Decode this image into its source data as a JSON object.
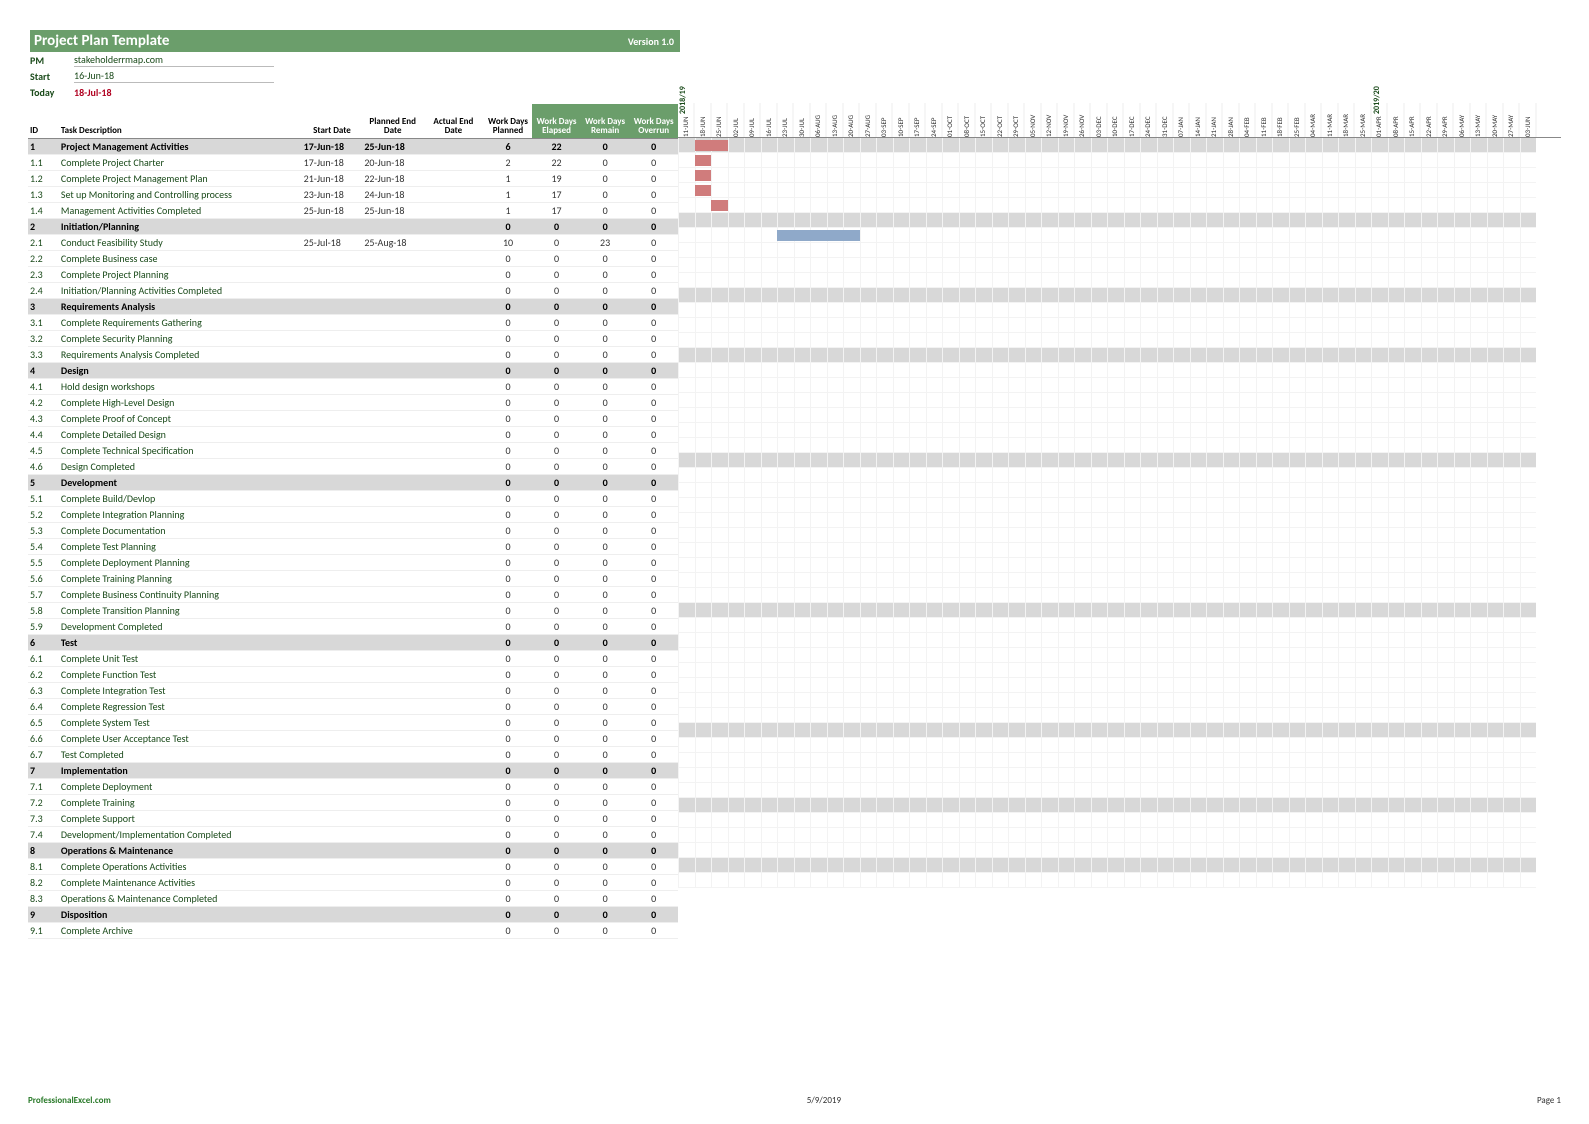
{
  "header": {
    "title": "Project Plan Template",
    "version": "Version 1.0",
    "pm_label": "PM",
    "pm_value": "stakeholderrmap.com",
    "start_label": "Start",
    "start_value": "16-Jun-18",
    "today_label": "Today",
    "today_value": "18-Jul-18"
  },
  "columns": {
    "id": "ID",
    "desc": "Task Description",
    "start": "Start Date",
    "planned_end": "Planned End Date",
    "actual_end": "Actual End Date",
    "wdp": "Work Days Planned",
    "wde": "Work Days Elapsed",
    "wdr": "Work Days Remain",
    "wdo": "Work Days Overrun"
  },
  "year_labels": [
    "2018/19",
    "2019/20"
  ],
  "timeline": [
    "11-JUN",
    "18-JUN",
    "25-JUN",
    "02-JUL",
    "09-JUL",
    "16-JUL",
    "23-JUL",
    "30-JUL",
    "06-AUG",
    "13-AUG",
    "20-AUG",
    "27-AUG",
    "03-SEP",
    "10-SEP",
    "17-SEP",
    "24-SEP",
    "01-OCT",
    "08-OCT",
    "15-OCT",
    "22-OCT",
    "29-OCT",
    "05-NOV",
    "12-NOV",
    "19-NOV",
    "26-NOV",
    "03-DEC",
    "10-DEC",
    "17-DEC",
    "24-DEC",
    "31-DEC",
    "07-JAN",
    "14-JAN",
    "21-JAN",
    "28-JAN",
    "04-FEB",
    "11-FEB",
    "18-FEB",
    "25-FEB",
    "04-MAR",
    "11-MAR",
    "18-MAR",
    "25-MAR",
    "01-APR",
    "08-APR",
    "15-APR",
    "22-APR",
    "29-APR",
    "06-MAY",
    "13-MAY",
    "20-MAY",
    "27-MAY",
    "03-JUN"
  ],
  "rows": [
    {
      "id": "1",
      "desc": "Project Management Activities",
      "start": "17-Jun-18",
      "pend": "25-Jun-18",
      "aend": "",
      "wdp": "6",
      "wde": "22",
      "wdr": "0",
      "wdo": "0",
      "phase": true,
      "bar": {
        "type": "planned",
        "start": 1,
        "span": 2
      }
    },
    {
      "id": "1.1",
      "desc": "Complete Project Charter",
      "start": "17-Jun-18",
      "pend": "20-Jun-18",
      "aend": "",
      "wdp": "2",
      "wde": "22",
      "wdr": "0",
      "wdo": "0",
      "bar": {
        "type": "planned",
        "start": 1,
        "span": 1
      }
    },
    {
      "id": "1.2",
      "desc": "Complete Project Management Plan",
      "start": "21-Jun-18",
      "pend": "22-Jun-18",
      "aend": "",
      "wdp": "1",
      "wde": "19",
      "wdr": "0",
      "wdo": "0",
      "bar": {
        "type": "planned",
        "start": 1,
        "span": 1
      }
    },
    {
      "id": "1.3",
      "desc": "Set up Monitoring and Controlling process",
      "start": "23-Jun-18",
      "pend": "24-Jun-18",
      "aend": "",
      "wdp": "1",
      "wde": "17",
      "wdr": "0",
      "wdo": "0",
      "bar": {
        "type": "planned",
        "start": 1,
        "span": 1
      }
    },
    {
      "id": "1.4",
      "desc": "Management Activities Completed",
      "start": "25-Jun-18",
      "pend": "25-Jun-18",
      "aend": "",
      "wdp": "1",
      "wde": "17",
      "wdr": "0",
      "wdo": "0",
      "bar": {
        "type": "planned",
        "start": 2,
        "span": 1
      }
    },
    {
      "id": "2",
      "desc": "Initiation/Planning",
      "start": "",
      "pend": "",
      "aend": "",
      "wdp": "0",
      "wde": "0",
      "wdr": "0",
      "wdo": "0",
      "phase": true
    },
    {
      "id": "2.1",
      "desc": "Conduct Feasibility Study",
      "start": "25-Jul-18",
      "pend": "25-Aug-18",
      "aend": "",
      "wdp": "10",
      "wde": "0",
      "wdr": "23",
      "wdo": "0",
      "bar": {
        "type": "actual",
        "start": 6,
        "span": 5
      }
    },
    {
      "id": "2.2",
      "desc": "Complete Business case",
      "start": "",
      "pend": "",
      "aend": "",
      "wdp": "0",
      "wde": "0",
      "wdr": "0",
      "wdo": "0"
    },
    {
      "id": "2.3",
      "desc": "Complete Project Planning",
      "start": "",
      "pend": "",
      "aend": "",
      "wdp": "0",
      "wde": "0",
      "wdr": "0",
      "wdo": "0"
    },
    {
      "id": "2.4",
      "desc": "Initiation/Planning Activities Completed",
      "start": "",
      "pend": "",
      "aend": "",
      "wdp": "0",
      "wde": "0",
      "wdr": "0",
      "wdo": "0"
    },
    {
      "id": "3",
      "desc": "Requirements Analysis",
      "start": "",
      "pend": "",
      "aend": "",
      "wdp": "0",
      "wde": "0",
      "wdr": "0",
      "wdo": "0",
      "phase": true
    },
    {
      "id": "3.1",
      "desc": "Complete Requirements Gathering",
      "start": "",
      "pend": "",
      "aend": "",
      "wdp": "0",
      "wde": "0",
      "wdr": "0",
      "wdo": "0"
    },
    {
      "id": "3.2",
      "desc": "Complete Security Planning",
      "start": "",
      "pend": "",
      "aend": "",
      "wdp": "0",
      "wde": "0",
      "wdr": "0",
      "wdo": "0"
    },
    {
      "id": "3.3",
      "desc": "Requirements Analysis Completed",
      "start": "",
      "pend": "",
      "aend": "",
      "wdp": "0",
      "wde": "0",
      "wdr": "0",
      "wdo": "0"
    },
    {
      "id": "4",
      "desc": "Design",
      "start": "",
      "pend": "",
      "aend": "",
      "wdp": "0",
      "wde": "0",
      "wdr": "0",
      "wdo": "0",
      "phase": true
    },
    {
      "id": "4.1",
      "desc": "Hold design workshops",
      "start": "",
      "pend": "",
      "aend": "",
      "wdp": "0",
      "wde": "0",
      "wdr": "0",
      "wdo": "0"
    },
    {
      "id": "4.2",
      "desc": "Complete High-Level Design",
      "start": "",
      "pend": "",
      "aend": "",
      "wdp": "0",
      "wde": "0",
      "wdr": "0",
      "wdo": "0"
    },
    {
      "id": "4.3",
      "desc": "Complete Proof of Concept",
      "start": "",
      "pend": "",
      "aend": "",
      "wdp": "0",
      "wde": "0",
      "wdr": "0",
      "wdo": "0"
    },
    {
      "id": "4.4",
      "desc": "Complete Detailed Design",
      "start": "",
      "pend": "",
      "aend": "",
      "wdp": "0",
      "wde": "0",
      "wdr": "0",
      "wdo": "0"
    },
    {
      "id": "4.5",
      "desc": "Complete Technical Specification",
      "start": "",
      "pend": "",
      "aend": "",
      "wdp": "0",
      "wde": "0",
      "wdr": "0",
      "wdo": "0"
    },
    {
      "id": "4.6",
      "desc": "Design Completed",
      "start": "",
      "pend": "",
      "aend": "",
      "wdp": "0",
      "wde": "0",
      "wdr": "0",
      "wdo": "0"
    },
    {
      "id": "5",
      "desc": "Development",
      "start": "",
      "pend": "",
      "aend": "",
      "wdp": "0",
      "wde": "0",
      "wdr": "0",
      "wdo": "0",
      "phase": true
    },
    {
      "id": "5.1",
      "desc": "Complete Build/Devlop",
      "start": "",
      "pend": "",
      "aend": "",
      "wdp": "0",
      "wde": "0",
      "wdr": "0",
      "wdo": "0"
    },
    {
      "id": "5.2",
      "desc": "Complete Integration Planning",
      "start": "",
      "pend": "",
      "aend": "",
      "wdp": "0",
      "wde": "0",
      "wdr": "0",
      "wdo": "0"
    },
    {
      "id": "5.3",
      "desc": "Complete Documentation",
      "start": "",
      "pend": "",
      "aend": "",
      "wdp": "0",
      "wde": "0",
      "wdr": "0",
      "wdo": "0"
    },
    {
      "id": "5.4",
      "desc": "Complete Test Planning",
      "start": "",
      "pend": "",
      "aend": "",
      "wdp": "0",
      "wde": "0",
      "wdr": "0",
      "wdo": "0"
    },
    {
      "id": "5.5",
      "desc": "Complete Deployment Planning",
      "start": "",
      "pend": "",
      "aend": "",
      "wdp": "0",
      "wde": "0",
      "wdr": "0",
      "wdo": "0"
    },
    {
      "id": "5.6",
      "desc": "Complete Training Planning",
      "start": "",
      "pend": "",
      "aend": "",
      "wdp": "0",
      "wde": "0",
      "wdr": "0",
      "wdo": "0"
    },
    {
      "id": "5.7",
      "desc": "Complete Business Continuity Planning",
      "start": "",
      "pend": "",
      "aend": "",
      "wdp": "0",
      "wde": "0",
      "wdr": "0",
      "wdo": "0"
    },
    {
      "id": "5.8",
      "desc": "Complete Transition Planning",
      "start": "",
      "pend": "",
      "aend": "",
      "wdp": "0",
      "wde": "0",
      "wdr": "0",
      "wdo": "0"
    },
    {
      "id": "5.9",
      "desc": "Development Completed",
      "start": "",
      "pend": "",
      "aend": "",
      "wdp": "0",
      "wde": "0",
      "wdr": "0",
      "wdo": "0"
    },
    {
      "id": "6",
      "desc": "Test",
      "start": "",
      "pend": "",
      "aend": "",
      "wdp": "0",
      "wde": "0",
      "wdr": "0",
      "wdo": "0",
      "phase": true
    },
    {
      "id": "6.1",
      "desc": "Complete Unit Test",
      "start": "",
      "pend": "",
      "aend": "",
      "wdp": "0",
      "wde": "0",
      "wdr": "0",
      "wdo": "0"
    },
    {
      "id": "6.2",
      "desc": "Complete Function Test",
      "start": "",
      "pend": "",
      "aend": "",
      "wdp": "0",
      "wde": "0",
      "wdr": "0",
      "wdo": "0"
    },
    {
      "id": "6.3",
      "desc": "Complete Integration Test",
      "start": "",
      "pend": "",
      "aend": "",
      "wdp": "0",
      "wde": "0",
      "wdr": "0",
      "wdo": "0"
    },
    {
      "id": "6.4",
      "desc": "Complete Regression Test",
      "start": "",
      "pend": "",
      "aend": "",
      "wdp": "0",
      "wde": "0",
      "wdr": "0",
      "wdo": "0"
    },
    {
      "id": "6.5",
      "desc": "Complete System Test",
      "start": "",
      "pend": "",
      "aend": "",
      "wdp": "0",
      "wde": "0",
      "wdr": "0",
      "wdo": "0"
    },
    {
      "id": "6.6",
      "desc": "Complete User Acceptance Test",
      "start": "",
      "pend": "",
      "aend": "",
      "wdp": "0",
      "wde": "0",
      "wdr": "0",
      "wdo": "0"
    },
    {
      "id": "6.7",
      "desc": "Test Completed",
      "start": "",
      "pend": "",
      "aend": "",
      "wdp": "0",
      "wde": "0",
      "wdr": "0",
      "wdo": "0"
    },
    {
      "id": "7",
      "desc": "Implementation",
      "start": "",
      "pend": "",
      "aend": "",
      "wdp": "0",
      "wde": "0",
      "wdr": "0",
      "wdo": "0",
      "phase": true
    },
    {
      "id": "7.1",
      "desc": "Complete Deployment",
      "start": "",
      "pend": "",
      "aend": "",
      "wdp": "0",
      "wde": "0",
      "wdr": "0",
      "wdo": "0"
    },
    {
      "id": "7.2",
      "desc": "Complete Training",
      "start": "",
      "pend": "",
      "aend": "",
      "wdp": "0",
      "wde": "0",
      "wdr": "0",
      "wdo": "0"
    },
    {
      "id": "7.3",
      "desc": "Complete  Support",
      "start": "",
      "pend": "",
      "aend": "",
      "wdp": "0",
      "wde": "0",
      "wdr": "0",
      "wdo": "0"
    },
    {
      "id": "7.4",
      "desc": "Development/Implementation Completed",
      "start": "",
      "pend": "",
      "aend": "",
      "wdp": "0",
      "wde": "0",
      "wdr": "0",
      "wdo": "0"
    },
    {
      "id": "8",
      "desc": "Operations & Maintenance",
      "start": "",
      "pend": "",
      "aend": "",
      "wdp": "0",
      "wde": "0",
      "wdr": "0",
      "wdo": "0",
      "phase": true
    },
    {
      "id": "8.1",
      "desc": "Complete Operations Activities",
      "start": "",
      "pend": "",
      "aend": "",
      "wdp": "0",
      "wde": "0",
      "wdr": "0",
      "wdo": "0"
    },
    {
      "id": "8.2",
      "desc": "Complete Maintenance Activities",
      "start": "",
      "pend": "",
      "aend": "",
      "wdp": "0",
      "wde": "0",
      "wdr": "0",
      "wdo": "0"
    },
    {
      "id": "8.3",
      "desc": "Operations & Maintenance Completed",
      "start": "",
      "pend": "",
      "aend": "",
      "wdp": "0",
      "wde": "0",
      "wdr": "0",
      "wdo": "0"
    },
    {
      "id": "9",
      "desc": "Disposition",
      "start": "",
      "pend": "",
      "aend": "",
      "wdp": "0",
      "wde": "0",
      "wdr": "0",
      "wdo": "0",
      "phase": true
    },
    {
      "id": "9.1",
      "desc": "Complete Archive",
      "start": "",
      "pend": "",
      "aend": "",
      "wdp": "0",
      "wde": "0",
      "wdr": "0",
      "wdo": "0"
    }
  ],
  "footer": {
    "site": "ProfessionalExcel.com",
    "date": "5/9/2019",
    "page": "Page 1"
  }
}
